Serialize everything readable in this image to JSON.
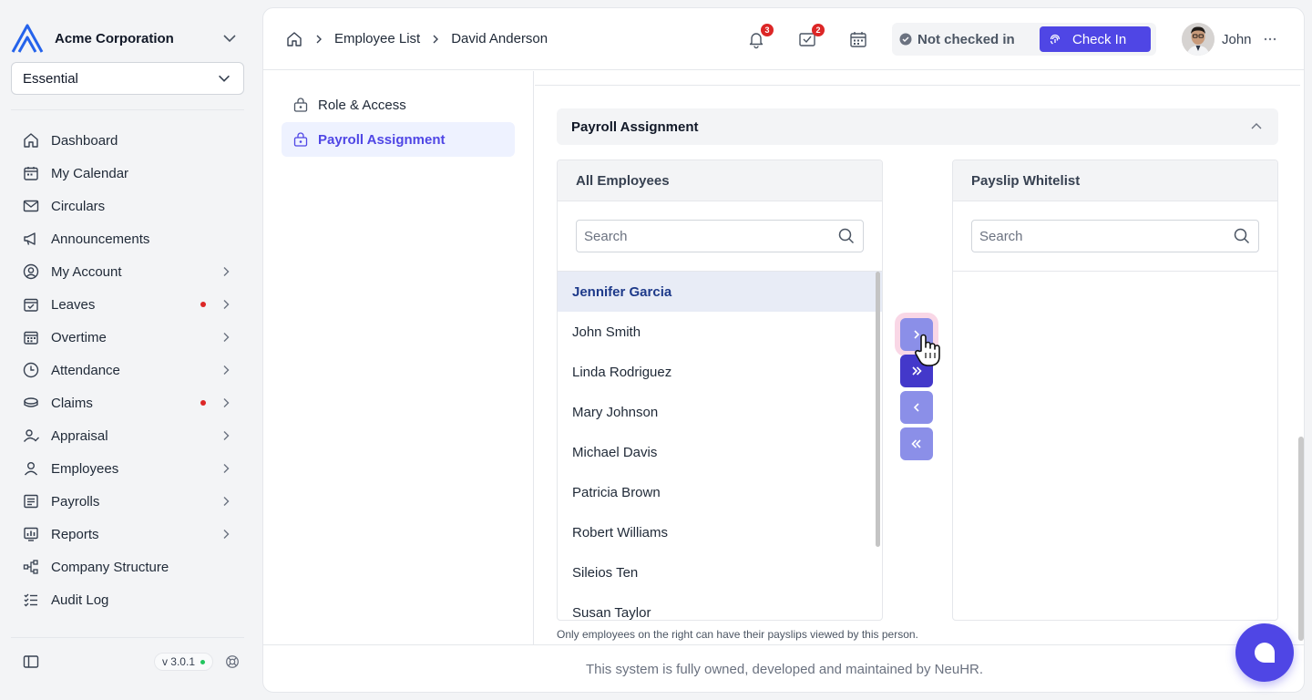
{
  "org": {
    "name": "Acme Corporation"
  },
  "plan_select": {
    "value": "Essential"
  },
  "nav": [
    {
      "label": "Dashboard",
      "icon": "home-icon",
      "arrow": false,
      "dot": false
    },
    {
      "label": "My Calendar",
      "icon": "calendar-icon",
      "arrow": false,
      "dot": false
    },
    {
      "label": "Circulars",
      "icon": "mail-icon",
      "arrow": false,
      "dot": false
    },
    {
      "label": "Announcements",
      "icon": "megaphone-icon",
      "arrow": false,
      "dot": false
    },
    {
      "label": "My Account",
      "icon": "user-circle-icon",
      "arrow": true,
      "dot": false
    },
    {
      "label": "Leaves",
      "icon": "calendar-check-icon",
      "arrow": true,
      "dot": true
    },
    {
      "label": "Overtime",
      "icon": "calendar-grid-icon",
      "arrow": true,
      "dot": false
    },
    {
      "label": "Attendance",
      "icon": "clock-icon",
      "arrow": true,
      "dot": false
    },
    {
      "label": "Claims",
      "icon": "coins-icon",
      "arrow": true,
      "dot": true
    },
    {
      "label": "Appraisal",
      "icon": "user-check-icon",
      "arrow": true,
      "dot": false
    },
    {
      "label": "Employees",
      "icon": "user-icon",
      "arrow": true,
      "dot": false
    },
    {
      "label": "Payrolls",
      "icon": "payroll-icon",
      "arrow": true,
      "dot": false
    },
    {
      "label": "Reports",
      "icon": "report-icon",
      "arrow": true,
      "dot": false
    },
    {
      "label": "Company Structure",
      "icon": "org-tree-icon",
      "arrow": false,
      "dot": false
    },
    {
      "label": "Audit Log",
      "icon": "checklist-icon",
      "arrow": false,
      "dot": false
    }
  ],
  "sidebar_footer": {
    "version": "v 3.0.1"
  },
  "breadcrumb": {
    "items": [
      "Employee List",
      "David Anderson"
    ]
  },
  "topbar": {
    "notifications_count": "3",
    "tasks_count": "2",
    "status_text": "Not checked in",
    "checkin_label": "Check In",
    "user_name": "John"
  },
  "subnav": [
    {
      "label": "Role & Access",
      "active": false
    },
    {
      "label": "Payroll Assignment",
      "active": true
    }
  ],
  "section": {
    "title": "Payroll Assignment"
  },
  "left_panel": {
    "title": "All Employees",
    "search_placeholder": "Search",
    "employees": [
      "Jennifer Garcia",
      "John Smith",
      "Linda Rodriguez",
      "Mary Johnson",
      "Michael Davis",
      "Patricia Brown",
      "Robert Williams",
      "Sileios Ten",
      "Susan Taylor"
    ],
    "selected": "Jennifer Garcia"
  },
  "right_panel": {
    "title": "Payslip Whitelist",
    "search_placeholder": "Search"
  },
  "hint": "Only employees on the right can have their payslips viewed by this person.",
  "footer": "This system is fully owned, developed and maintained by NeuHR.",
  "colors": {
    "accent": "#4f46e5",
    "badge": "#dc2626",
    "online": "#22c55e"
  }
}
